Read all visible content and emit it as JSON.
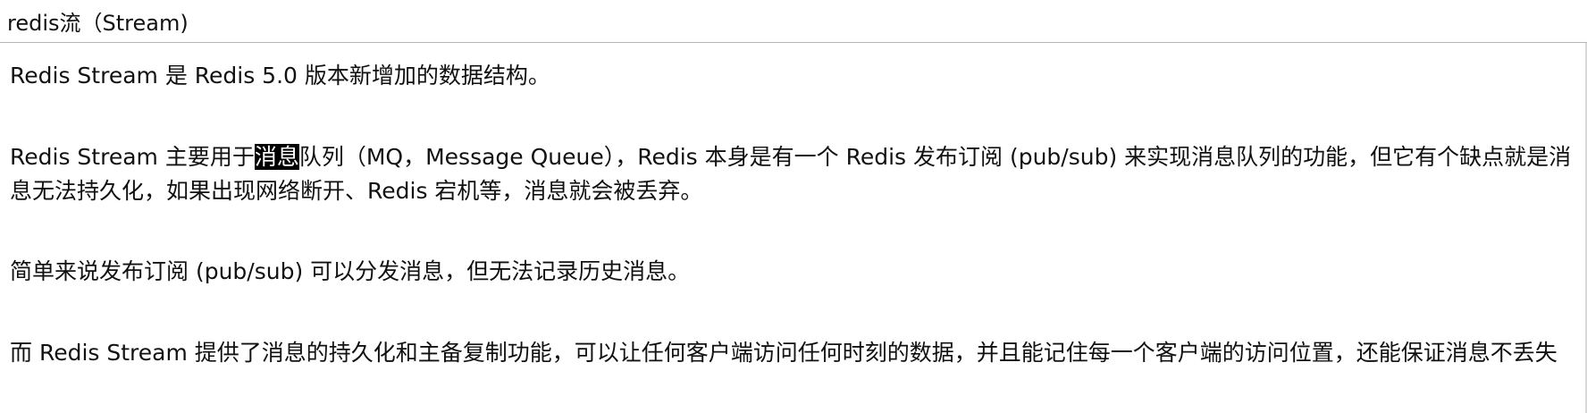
{
  "header": {
    "title": "redis流（Stream)"
  },
  "paragraphs": {
    "p1": "Redis Stream 是 Redis 5.0 版本新增加的数据结构。",
    "p2_before": "Redis Stream 主要用于",
    "p2_highlight": "消息",
    "p2_after": "队列（MQ，Message Queue），Redis 本身是有一个 Redis 发布订阅 (pub/sub) 来实现消息队列的功能，但它有个缺点就是消息无法持久化，如果出现网络断开、Redis 宕机等，消息就会被丢弃。",
    "p3": "简单来说发布订阅 (pub/sub) 可以分发消息，但无法记录历史消息。",
    "p4": "而 Redis Stream 提供了消息的持久化和主备复制功能，可以让任何客户端访问任何时刻的数据，并且能记住每一个客户端的访问位置，还能保证消息不丢失"
  },
  "colors": {
    "text": "#111111",
    "highlight_bg": "#000000",
    "highlight_text": "#ffffff",
    "header_border": "#b5b5b5"
  }
}
